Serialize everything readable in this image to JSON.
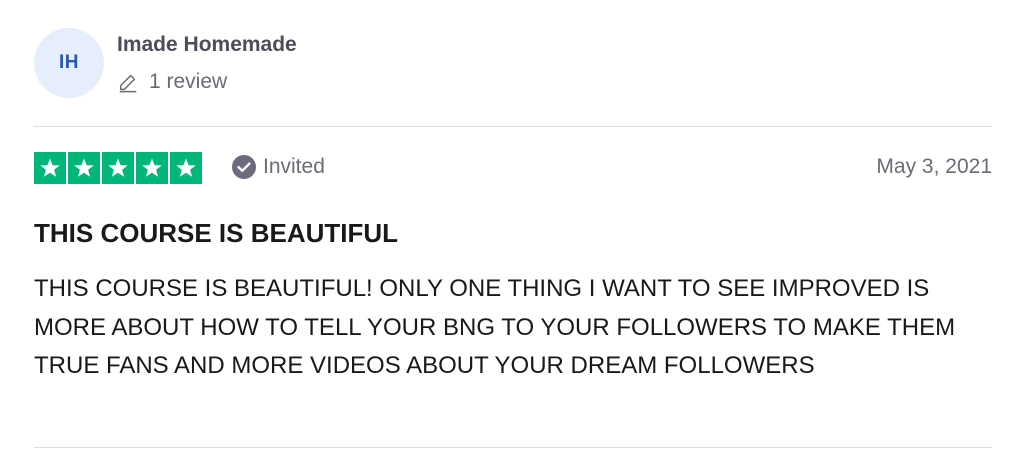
{
  "reviewer": {
    "initials": "IH",
    "name": "Imade Homemade",
    "review_count": "1 review"
  },
  "rating": {
    "stars": 5,
    "max_stars": 5,
    "star_color": "#00b67a"
  },
  "status": {
    "label": "Invited",
    "icon": "check-circle-icon"
  },
  "date": "May 3, 2021",
  "review": {
    "title": "THIS COURSE IS BEAUTIFUL",
    "body": "THIS COURSE IS BEAUTIFUL! ONLY ONE THING I WANT TO SEE IMPROVED IS MORE ABOUT HOW TO TELL YOUR BNG TO YOUR FOLLOWERS TO MAKE THEM TRUE FANS AND MORE VIDEOS ABOUT YOUR DREAM FOLLOWERS"
  }
}
